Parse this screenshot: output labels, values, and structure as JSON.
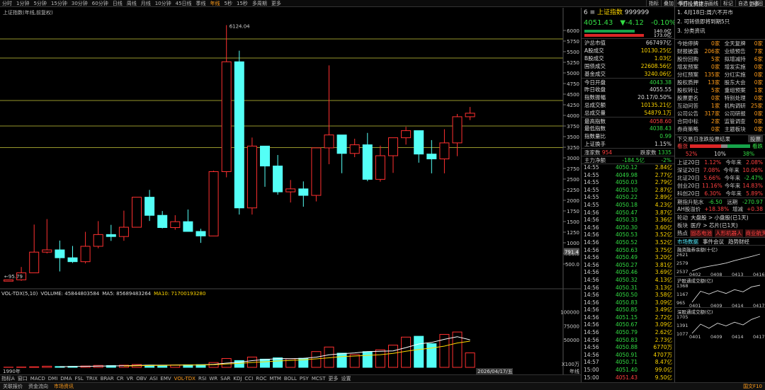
{
  "topbar": {
    "periods": [
      "分时",
      "1分钟",
      "5分钟",
      "15分钟",
      "30分钟",
      "60分钟",
      "日线",
      "周线",
      "月线",
      "10分钟",
      "45日线",
      "季线",
      "年线",
      "5秒",
      "15秒",
      "多周期",
      "更多"
    ],
    "active": "年线",
    "tools": [
      "指标",
      "叠加",
      "事件",
      "统计",
      "画线",
      "标记",
      "自选",
      "返回"
    ]
  },
  "chart": {
    "label": "上证指数(年线,前复权)",
    "yticks": [
      "6000",
      "5750",
      "5500",
      "5250",
      "5000",
      "4750",
      "4500",
      "4250",
      "4000",
      "3750",
      "3500",
      "3250",
      "3000",
      "2750",
      "2500",
      "2250",
      "2000",
      "1750",
      "1500",
      "1250",
      "1000",
      "750.0",
      "500.0"
    ],
    "high_label": "6124.04",
    "low_label": "95.79",
    "cursor_price": "791.4",
    "start_year": "1990年",
    "end_date": "2026/04/17/五",
    "period": "年线",
    "unit": "X100万"
  },
  "chart_data": {
    "type": "candlestick",
    "ylim": [
      0,
      6300
    ],
    "candles": [
      {
        "o": 96,
        "c": 128,
        "h": 128,
        "l": 96
      },
      {
        "o": 128,
        "c": 293,
        "h": 430,
        "l": 105
      },
      {
        "o": 293,
        "c": 780,
        "h": 1429,
        "l": 386
      },
      {
        "o": 780,
        "c": 833,
        "h": 1558,
        "l": 750
      },
      {
        "o": 833,
        "c": 647,
        "h": 1052,
        "l": 325
      },
      {
        "o": 647,
        "c": 555,
        "h": 926,
        "l": 524
      },
      {
        "o": 555,
        "c": 917,
        "h": 1258,
        "l": 512
      },
      {
        "o": 917,
        "c": 1194,
        "h": 1510,
        "l": 870
      },
      {
        "o": 1194,
        "c": 1147,
        "h": 1422,
        "l": 1044
      },
      {
        "o": 1147,
        "c": 1366,
        "h": 1757,
        "l": 1047
      },
      {
        "o": 1366,
        "c": 2073,
        "h": 2073,
        "l": 1361
      },
      {
        "o": 2073,
        "c": 1646,
        "h": 2245,
        "l": 1514
      },
      {
        "o": 1646,
        "c": 1358,
        "h": 1748,
        "l": 1339
      },
      {
        "o": 1358,
        "c": 1497,
        "h": 1649,
        "l": 1307
      },
      {
        "o": 1497,
        "c": 1267,
        "h": 1783,
        "l": 1259
      },
      {
        "o": 1267,
        "c": 1161,
        "h": 1329,
        "l": 998
      },
      {
        "o": 1161,
        "c": 2675,
        "h": 2698,
        "l": 1161
      },
      {
        "o": 2675,
        "c": 5262,
        "h": 6124,
        "l": 2541
      },
      {
        "o": 5262,
        "c": 1821,
        "h": 5522,
        "l": 1664
      },
      {
        "o": 1821,
        "c": 3277,
        "h": 3478,
        "l": 1665
      },
      {
        "o": 3277,
        "c": 2808,
        "h": 3186,
        "l": 2319
      },
      {
        "o": 2808,
        "c": 2199,
        "h": 3067,
        "l": 2132
      },
      {
        "o": 2199,
        "c": 2269,
        "h": 2478,
        "l": 1949
      },
      {
        "o": 2269,
        "c": 2116,
        "h": 2445,
        "l": 1849
      },
      {
        "o": 2116,
        "c": 3235,
        "h": 3239,
        "l": 1974
      },
      {
        "o": 3235,
        "c": 3539,
        "h": 5178,
        "l": 2850
      },
      {
        "o": 3539,
        "c": 3104,
        "h": 3301,
        "l": 2638
      },
      {
        "o": 3104,
        "c": 3307,
        "h": 3450,
        "l": 3016
      },
      {
        "o": 3307,
        "c": 2494,
        "h": 3587,
        "l": 2449
      },
      {
        "o": 2494,
        "c": 3050,
        "h": 3288,
        "l": 2440
      },
      {
        "o": 3050,
        "c": 3473,
        "h": 3474,
        "l": 2646
      },
      {
        "o": 3473,
        "c": 3640,
        "h": 3731,
        "l": 3312
      },
      {
        "o": 3640,
        "c": 3089,
        "h": 3424,
        "l": 2886
      },
      {
        "o": 3089,
        "c": 2975,
        "h": 3418,
        "l": 2635
      },
      {
        "o": 2975,
        "c": 3352,
        "h": 3674,
        "l": 2635
      },
      {
        "o": 3352,
        "c": 3968,
        "h": 4034,
        "l": 3040
      },
      {
        "o": 3968,
        "c": 4051,
        "h": 4198,
        "l": 3889
      }
    ],
    "volume": [
      0.3,
      0.6,
      1.0,
      2.1,
      1.5,
      1.8,
      2.4,
      3.5,
      3.2,
      3.9,
      5.1,
      4.0,
      3.6,
      4.2,
      4.6,
      4.9,
      8.7,
      16.0,
      12.3,
      18.6,
      14.8,
      17.2,
      15.4,
      16.3,
      28.5,
      36.7,
      25.6,
      23.1,
      28.4,
      31.7,
      40.1,
      54.6,
      56.1,
      42.7,
      59.5,
      63.8,
      26.1
    ],
    "ma5": [
      null,
      null,
      null,
      null,
      1.1,
      1.5,
      1.8,
      2.3,
      2.5,
      3.0,
      3.6,
      3.9,
      4.0,
      4.2,
      4.3,
      4.5,
      5.4,
      7.7,
      9.3,
      12.1,
      14.1,
      15.8,
      15.7,
      16.4,
      18.4,
      22.7,
      24.6,
      26.1,
      28.5,
      29.1,
      29.8,
      35.6,
      42.2,
      45.0,
      50.6,
      55.3,
      49.7
    ],
    "ma10": [
      null,
      null,
      null,
      null,
      null,
      null,
      null,
      null,
      null,
      2.4,
      2.9,
      3.3,
      3.6,
      4.0,
      4.2,
      4.3,
      4.9,
      6.1,
      7.2,
      8.8,
      10.1,
      11.5,
      12.4,
      13.5,
      15.3,
      17.2,
      19.4,
      20.4,
      21.6,
      22.9,
      25.3,
      29.0,
      32.2,
      34.8,
      38.3,
      43.9,
      47.3
    ]
  },
  "vol_legend": {
    "name": "VOL-TDX(5,10)",
    "volume_label": "VOLUME: 45844803584",
    "ma5_label": "MA5: 85689483264",
    "ma10_label": "MA10: 71700193280",
    "yticks": [
      "100000",
      "75000",
      "50000"
    ]
  },
  "indicators": [
    "指标A",
    "窗口",
    "MACD",
    "DMI",
    "DMA",
    "FSL",
    "TRIX",
    "BRAR",
    "CR",
    "VR",
    "OBV",
    "ASI",
    "EMV",
    "VOL-TDX",
    "RSI",
    "WR",
    "SAR",
    "KDJ",
    "CCI",
    "ROC",
    "MTM",
    "BOLL",
    "PSY",
    "MCST",
    "更多",
    "设置"
  ],
  "active_indicator": "VOL-TDX",
  "bottom2": [
    "关联报价",
    "资金流向",
    "市场资讯"
  ],
  "bottom2_active": "市场资讯",
  "bottom_right": "国文F10",
  "index": {
    "code": "6",
    "name": "上证指数",
    "num": "999999",
    "price": "4051.43",
    "change": "▼-4.12",
    "pct": "-0.10%",
    "buy_vol": "140.0亿",
    "sell_vol": "173.0亿"
  },
  "stats": [
    {
      "k": "沪总市值",
      "v": "667497亿",
      "c": "white"
    },
    {
      "k": "A股成交",
      "v": "10130.25亿",
      "c": "yellow"
    },
    {
      "k": "B股成交",
      "v": "1.03亿",
      "c": "yellow"
    },
    {
      "k": "国债成交",
      "v": "22608.56亿",
      "c": "yellow"
    },
    {
      "k": "基金成交",
      "v": "3240.06亿",
      "c": "yellow"
    },
    {
      "k": "今日开盘",
      "v": "4043.38",
      "c": "green"
    },
    {
      "k": "昨日收盘",
      "v": "4055.55",
      "c": "white"
    },
    {
      "k": "指数振幅",
      "v": "20.17/0.50%",
      "c": "white"
    },
    {
      "k": "总成交额",
      "v": "10135.21亿",
      "c": "yellow"
    },
    {
      "k": "总成交量",
      "v": "54879.1万",
      "c": "yellow"
    },
    {
      "k": "最高指数",
      "v": "4058.60",
      "c": "red"
    },
    {
      "k": "最低指数",
      "v": "4038.43",
      "c": "green"
    },
    {
      "k": "指数量比",
      "v": "0.99",
      "c": "green"
    },
    {
      "k": "上证换手",
      "v": "1.15%",
      "c": "white"
    }
  ],
  "updown": {
    "up_label": "涨家数",
    "up": "954",
    "down_label": "跌家数",
    "down": "1335"
  },
  "flow": {
    "label": "主力净额",
    "v1": "-184.5亿",
    "v2": "-2%"
  },
  "trades": [
    [
      "14:55",
      "4050.12",
      "2.84亿"
    ],
    [
      "14:55",
      "4049.98",
      "2.77亿"
    ],
    [
      "14:55",
      "4050.03",
      "2.79亿"
    ],
    [
      "14:55",
      "4050.10",
      "2.87亿"
    ],
    [
      "14:55",
      "4050.22",
      "2.89亿"
    ],
    [
      "14:55",
      "4050.18",
      "4.23亿"
    ],
    [
      "14:56",
      "4050.47",
      "3.87亿"
    ],
    [
      "14:56",
      "4050.33",
      "3.36亿"
    ],
    [
      "14:56",
      "4050.30",
      "3.60亿"
    ],
    [
      "14:56",
      "4050.53",
      "3.52亿"
    ],
    [
      "14:56",
      "4050.52",
      "3.52亿"
    ],
    [
      "14:56",
      "4050.63",
      "3.75亿"
    ],
    [
      "14:56",
      "4050.49",
      "3.20亿"
    ],
    [
      "14:56",
      "4050.27",
      "3.81亿"
    ],
    [
      "14:56",
      "4050.46",
      "3.69亿"
    ],
    [
      "14:56",
      "4050.32",
      "4.13亿"
    ],
    [
      "14:56",
      "4050.31",
      "3.13亿"
    ],
    [
      "14:56",
      "4050.50",
      "3.58亿"
    ],
    [
      "14:56",
      "4050.83",
      "3.09亿"
    ],
    [
      "14:56",
      "4050.85",
      "3.49亿"
    ],
    [
      "14:56",
      "4051.15",
      "2.72亿"
    ],
    [
      "14:56",
      "4050.67",
      "3.09亿"
    ],
    [
      "14:56",
      "4050.79",
      "2.62亿"
    ],
    [
      "14:56",
      "4050.83",
      "2.73亿"
    ],
    [
      "14:56",
      "4050.88",
      "6770万"
    ],
    [
      "14:56",
      "4050.91",
      "4707万"
    ],
    [
      "14:57",
      "4050.71",
      "8.47亿"
    ],
    [
      "15:00",
      "4051.40",
      "99.0亿"
    ],
    [
      "15:00",
      "4051.43",
      "9.50亿"
    ]
  ],
  "r2": {
    "title": "今日投资提示",
    "more": "更多..",
    "tips": [
      "1. 4月18日:周六不开市",
      "2. 可转债即将到期5只",
      "3. 分类资讯"
    ],
    "events": [
      [
        "今始停牌",
        "0家",
        "全天复牌",
        "0家"
      ],
      [
        "财报披露",
        "206家",
        "业绩预告",
        "7家"
      ],
      [
        "股份回购",
        "5家",
        "拟增减持",
        "6家"
      ],
      [
        "增发预案",
        "0家",
        "增发实施",
        "0家"
      ],
      [
        "分红预案",
        "135家",
        "分红实施",
        "0家"
      ],
      [
        "股权质押",
        "13家",
        "股东大会",
        "0家"
      ],
      [
        "股权转让",
        "5家",
        "重组预案",
        "1家"
      ],
      [
        "股票更名",
        "0家",
        "特别处理",
        "0家"
      ],
      [
        "互动问答",
        "1家",
        "机构调研",
        "25家"
      ],
      [
        "公司公告",
        "317家",
        "公司研报",
        "0家"
      ],
      [
        "合同中标",
        "2家",
        "监管调查",
        "0家"
      ],
      [
        "券商策略",
        "0家",
        "主题板块",
        "0家"
      ]
    ],
    "dist_title": "下交易日涨跌投票结果",
    "vote": "投票",
    "dist": {
      "up_label": "看涨",
      "down_label": "看跌",
      "up": "52%",
      "mid": "10%",
      "down": "38%"
    },
    "cmp": [
      [
        "上证20日",
        "1.12%",
        "今年来",
        "2.08%"
      ],
      [
        "深证20日",
        "7.08%",
        "今年来",
        "10.06%"
      ],
      [
        "北证20日",
        "5.66%",
        "今年来",
        "-2.47%"
      ],
      [
        "创业20日",
        "11.16%",
        "今年来",
        "14.83%"
      ],
      [
        "科创20日",
        "6.30%",
        "今年来",
        "5.89%"
      ]
    ],
    "futures": {
      "k": "期指升贴水",
      "v1": "-6.50",
      "k2": "远期",
      "v2": "-270.97"
    },
    "ah": {
      "k": "AH股溢价",
      "v1": "+18.38%",
      "k2": "增减",
      "v2": "+0.38"
    },
    "rotation": [
      [
        "轮动",
        "大盘股 > 小盘股(已1天)"
      ],
      [
        "板块",
        "医疗 > 芯片(已1天)"
      ]
    ],
    "hot": [
      "热点",
      "固态电池",
      "人形机器人",
      "商业航天"
    ],
    "tabs": [
      "市场数据",
      "事件会议",
      "趋势财经"
    ],
    "charts": [
      {
        "title": "融资融券余额(十亿)",
        "ticks": [
          "2621",
          "2579",
          "2537"
        ],
        "dates": [
          "0402",
          "0408",
          "0413",
          "0416"
        ],
        "values": [
          2540,
          2555,
          2563,
          2570,
          2578,
          2590,
          2600,
          2610,
          2621
        ]
      },
      {
        "title": "沪股通成交额(亿)",
        "ticks": [
          "1368",
          "1167",
          "965"
        ],
        "dates": [
          "0401",
          "0409",
          "0414",
          "0417"
        ],
        "values": [
          1000,
          1200,
          1150,
          1210,
          1160,
          1230,
          1190,
          1280,
          1310
        ]
      },
      {
        "title": "深股通成交额(亿)",
        "ticks": [
          "1705",
          "1391",
          "1077"
        ],
        "dates": [
          "0401",
          "0409",
          "0414",
          "0417"
        ],
        "values": [
          1150,
          1420,
          1300,
          1450,
          1370,
          1480,
          1400,
          1560,
          1650
        ]
      }
    ]
  }
}
